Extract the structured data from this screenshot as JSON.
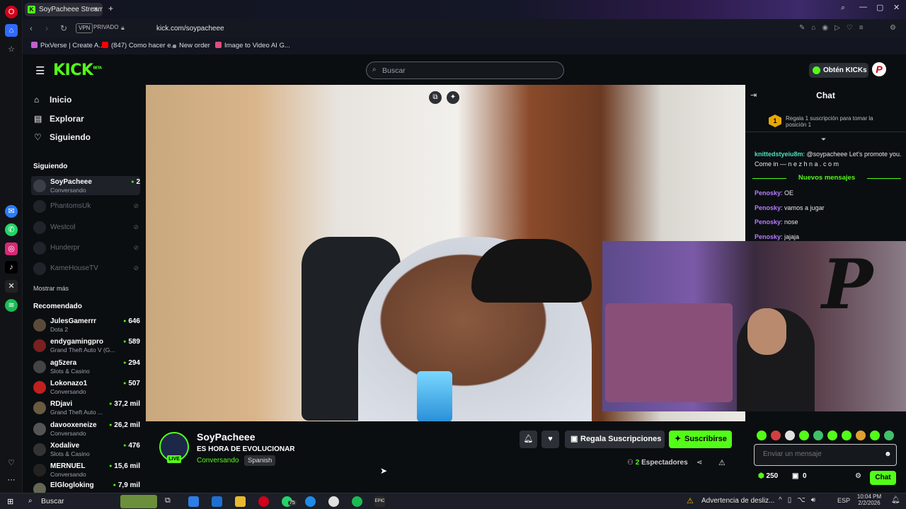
{
  "browser": {
    "tab_title": "SoyPacheee Stream -",
    "new_tab": "+",
    "vpn": "VPN",
    "private": "PRIVADO",
    "url": "kick.com/soypacheee",
    "bookmarks": [
      "PixVerse | Create A...",
      "(847) Como hacer e...",
      "New order",
      "Image to Video AI G..."
    ]
  },
  "header": {
    "logo": "KICK",
    "logo_badge": "BETA",
    "search_placeholder": "Buscar",
    "kicks_button": "Obtén KICKs"
  },
  "sidebar": {
    "nav": [
      {
        "label": "Inicio"
      },
      {
        "label": "Explorar"
      },
      {
        "label": "Siguiendo"
      }
    ],
    "following_title": "Siguiendo",
    "following": [
      {
        "name": "SoyPacheee",
        "sub": "Conversando",
        "viewers": "2"
      },
      {
        "name": "PhantomsUk"
      },
      {
        "name": "Westcol"
      },
      {
        "name": "Hunderpr"
      },
      {
        "name": "KameHouseTV"
      }
    ],
    "show_more": "Mostrar más",
    "recommended_title": "Recomendado",
    "recommended": [
      {
        "name": "JulesGamerrr",
        "sub": "Dota 2",
        "viewers": "646"
      },
      {
        "name": "endygamingpro",
        "sub": "Grand Theft Auto V (G...",
        "viewers": "589"
      },
      {
        "name": "ag5zera",
        "sub": "Slots & Casino",
        "viewers": "294"
      },
      {
        "name": "Lokonazo1",
        "sub": "Conversando",
        "viewers": "507"
      },
      {
        "name": "RDjavi",
        "sub": "Grand Theft Auto ...",
        "viewers": "37,2 mil"
      },
      {
        "name": "davooxeneize",
        "sub": "Conversando",
        "viewers": "26,2 mil"
      },
      {
        "name": "Xodalive",
        "sub": "Slots & Casino",
        "viewers": "476"
      },
      {
        "name": "MERNUEL",
        "sub": "Conversando",
        "viewers": "15,6 mil"
      },
      {
        "name": "ElGlogloking",
        "sub": "",
        "viewers": "7,9 mil"
      }
    ]
  },
  "stream": {
    "channel": "SoyPacheee",
    "title": "ES HORA DE EVOLUCIONAR",
    "category": "Conversando",
    "language": "Spanish",
    "live_badge": "LIVE",
    "gift_button": "Regala Suscripciones",
    "subscribe_button": "Suscribirse",
    "viewers_count": "2",
    "viewers_label": "Espectadores"
  },
  "chat": {
    "title": "Chat",
    "gift_prompt": "Regala 1 suscripción para tomar la posición 1",
    "messages": [
      {
        "user": "knittedstyeiu8m",
        "text": "@soypacheee Let's promote you. Come in — n e z h n a . c o m",
        "color": "#4ee0c0"
      },
      {
        "user": "Penosky",
        "text": "OE",
        "color": "#b57cff"
      },
      {
        "user": "Penosky",
        "text": "vamos a jugar",
        "color": "#b57cff"
      },
      {
        "user": "Penosky",
        "text": "nose",
        "color": "#b57cff"
      },
      {
        "user": "Penosky",
        "text": "jajaja",
        "color": "#b57cff"
      }
    ],
    "new_messages": "Nuevos mensajes",
    "input_placeholder": "Enviar un mensaje",
    "kicks_count": "250",
    "gifts_count": "0",
    "send_button": "Chat"
  },
  "taskbar": {
    "search": "Buscar",
    "whatsapp_badge": "75",
    "notification": "Advertencia de desliz...",
    "lang": "ESP",
    "time": "10:04 PM",
    "date": "2/2/2026"
  },
  "colors": {
    "accent": "#53fc18",
    "bg": "#0b0e11"
  }
}
